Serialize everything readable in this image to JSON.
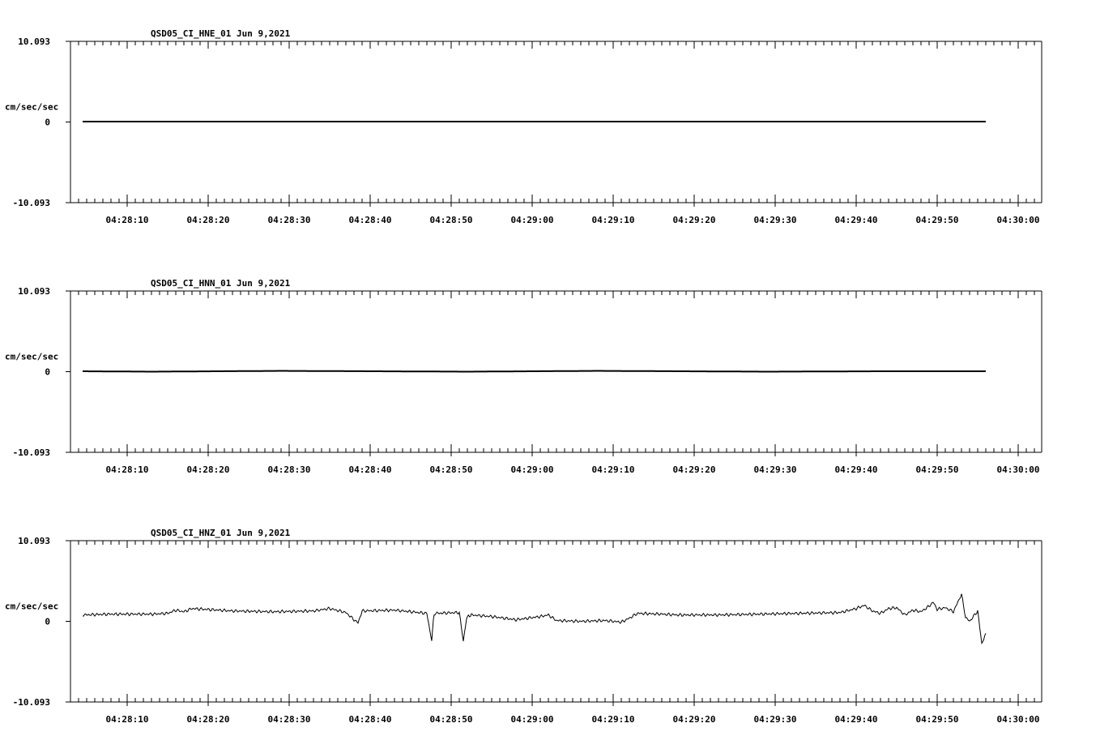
{
  "chart_data": [
    {
      "type": "line",
      "title": "QSD05_CI_HNE_01  Jun 9,2021",
      "ylabel": "cm/sec/sec",
      "ylim": [
        -10.093,
        10.093
      ],
      "ytick_labels": [
        "10.093",
        "0",
        "-10.093"
      ],
      "xtick_labels": [
        "04:28:10",
        "04:28:20",
        "04:28:30",
        "04:28:40",
        "04:28:50",
        "04:29:00",
        "04:29:10",
        "04:29:20",
        "04:29:30",
        "04:29:40",
        "04:29:50",
        "04:30:00"
      ],
      "xlim_seconds": [
        0,
        113
      ],
      "trace_start_seconds": 1.5,
      "series": [
        {
          "x": [
            1.5,
            20,
            40,
            60,
            80,
            100,
            113
          ],
          "y": [
            0.05,
            0.05,
            0.05,
            0.05,
            0.05,
            0.05,
            0.05
          ]
        }
      ]
    },
    {
      "type": "line",
      "title": "QSD05_CI_HNN_01  Jun 9,2021",
      "ylabel": "cm/sec/sec",
      "ylim": [
        -10.093,
        10.093
      ],
      "ytick_labels": [
        "10.093",
        "0",
        "-10.093"
      ],
      "xtick_labels": [
        "04:28:10",
        "04:28:20",
        "04:28:30",
        "04:28:40",
        "04:28:50",
        "04:29:00",
        "04:29:10",
        "04:29:20",
        "04:29:30",
        "04:29:40",
        "04:29:50",
        "04:30:00"
      ],
      "xlim_seconds": [
        0,
        113
      ],
      "trace_start_seconds": 1.5,
      "series": [
        {
          "x": [
            1.5,
            10,
            26,
            49,
            65,
            86,
            100,
            113
          ],
          "y": [
            0.05,
            0.0,
            0.1,
            0.0,
            0.1,
            0.0,
            0.05,
            0.05
          ]
        }
      ]
    },
    {
      "type": "line",
      "title": "QSD05_CI_HNZ_01  Jun 9,2021",
      "ylabel": "cm/sec/sec",
      "ylim": [
        -10.093,
        10.093
      ],
      "ytick_labels": [
        "10.093",
        "0",
        "-10.093"
      ],
      "xtick_labels": [
        "04:28:10",
        "04:28:20",
        "04:28:30",
        "04:28:40",
        "04:28:50",
        "04:29:00",
        "04:29:10",
        "04:29:20",
        "04:29:30",
        "04:29:40",
        "04:29:50",
        "04:30:00"
      ],
      "xlim_seconds": [
        0,
        113
      ],
      "trace_start_seconds": 1.5,
      "series": [
        {
          "x": [
            1.5,
            5,
            10,
            12,
            13,
            14,
            15,
            20,
            25,
            30,
            32,
            34,
            35,
            35.5,
            36,
            40,
            42,
            44,
            44.6,
            44.8,
            45,
            48,
            48.5,
            48.9,
            49.5,
            52,
            55,
            58,
            59,
            60,
            63,
            66,
            68,
            69,
            70,
            73,
            75,
            80,
            85,
            90,
            95,
            97,
            98,
            99,
            100,
            101,
            102,
            103,
            104,
            105,
            106,
            106.5,
            107,
            108,
            109,
            110,
            110.5,
            111,
            112,
            112.5,
            113
          ],
          "y": [
            0.8,
            0.9,
            0.9,
            1.0,
            1.4,
            1.2,
            1.6,
            1.3,
            1.2,
            1.3,
            1.6,
            1.1,
            0.2,
            -0.2,
            1.3,
            1.4,
            1.2,
            1.0,
            -2.5,
            0.3,
            1.0,
            1.1,
            -2.5,
            0.5,
            0.8,
            0.6,
            0.2,
            0.6,
            0.8,
            0.1,
            0.0,
            0.1,
            -0.1,
            0.4,
            1.0,
            0.9,
            0.8,
            0.8,
            0.9,
            1.0,
            1.1,
            1.6,
            2.0,
            1.3,
            1.0,
            1.6,
            1.7,
            0.8,
            1.4,
            1.2,
            1.9,
            2.4,
            1.5,
            1.7,
            1.2,
            3.4,
            0.5,
            0.0,
            1.3,
            -2.8,
            -1.5
          ]
        }
      ]
    }
  ]
}
